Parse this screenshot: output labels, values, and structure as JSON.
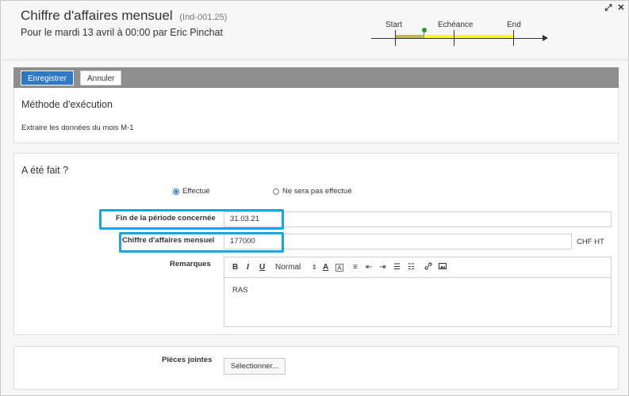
{
  "header": {
    "title": "Chiffre d'affaires mensuel",
    "reference": "(Ind-001.25)",
    "subtitle": "Pour le mardi 13 avril à 00:00 par Eric Pinchat"
  },
  "window_controls": {
    "expand_icon": "expand-icon",
    "close_icon": "close-icon",
    "expand_glyph": "⤢",
    "close_glyph": "✕"
  },
  "timeline": {
    "start_label": "Start",
    "due_label": "Echéance",
    "end_label": "End",
    "colors": {
      "elapsed": "#c4b94a",
      "remaining": "#ffff10",
      "marker": "#2e9a2e"
    }
  },
  "toolbar": {
    "save_label": "Enregistrer",
    "cancel_label": "Annuler"
  },
  "method": {
    "title": "Méthode d'exécution",
    "text": "Extraire les données du mois M-1"
  },
  "status": {
    "title": "A été fait ?",
    "options": [
      {
        "label": "Effectué",
        "selected": true
      },
      {
        "label": "Ne sera pas effectué",
        "selected": false
      }
    ]
  },
  "fields": {
    "period_end": {
      "label": "Fin de la période concernée",
      "value": "31.03.21"
    },
    "revenue": {
      "label": "Chiffre d'affaires mensuel",
      "value": "177000",
      "unit": "CHF HT"
    },
    "remarks": {
      "label": "Remarques",
      "value": "RAS",
      "format_select": "Normal",
      "toolbar_glyphs": {
        "bold": "B",
        "italic": "I",
        "underline": "U",
        "font_color": "A",
        "background_color": "A",
        "align": "≡",
        "outdent": "⇤",
        "indent": "⇥",
        "bullet_list": "☰",
        "ordered_list": "☷",
        "link": "🔗",
        "image": "▣"
      }
    }
  },
  "attachments": {
    "label": "Pièces jointes",
    "button_label": "Sélectionner..."
  },
  "colors": {
    "primary": "#2f78c4",
    "highlight": "#12a7e5",
    "toolbar_bg": "#8e8e8e"
  }
}
